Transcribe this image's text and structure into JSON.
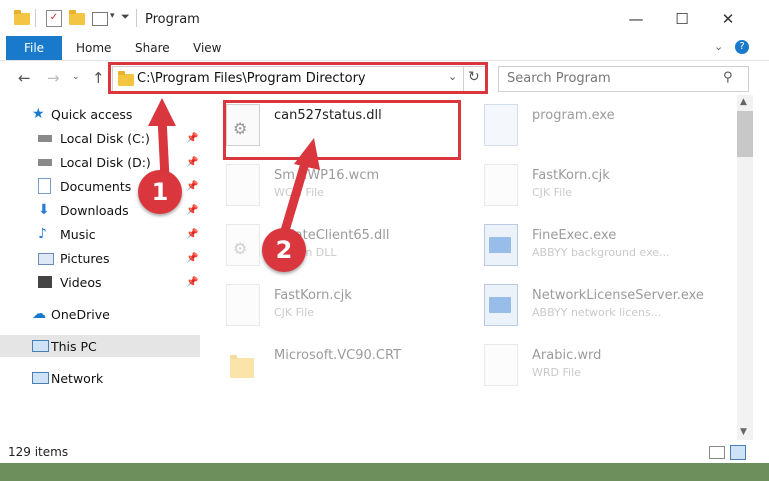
{
  "window": {
    "title": "Program"
  },
  "ribbon": {
    "tabs": [
      "File",
      "Home",
      "Share",
      "View"
    ]
  },
  "address": {
    "path": "C:\\Program Files\\Program Directory"
  },
  "search": {
    "placeholder": "Search Program"
  },
  "nav": {
    "quick_access": "Quick access",
    "items": [
      "Local Disk (C:)",
      "Local Disk (D:)",
      "Documents",
      "Downloads",
      "Music",
      "Pictures",
      "Videos"
    ],
    "onedrive": "OneDrive",
    "thispc": "This PC",
    "network": "Network"
  },
  "files": [
    {
      "name": "can527status.dll",
      "sub": ""
    },
    {
      "name": "program.exe",
      "sub": ""
    },
    {
      "name": "Sm...WP16.wcm",
      "sub": "WCM File"
    },
    {
      "name": "FastKorn.cjk",
      "sub": "CJK File"
    },
    {
      "name": "...dateClient65.dll",
      "sub": "...ation DLL"
    },
    {
      "name": "FineExec.exe",
      "sub": "ABBYY background exe..."
    },
    {
      "name": "FastKorn.cjk",
      "sub": "CJK File"
    },
    {
      "name": "NetworkLicenseServer.exe",
      "sub": "ABBYY network licens..."
    },
    {
      "name": "Microsoft.VC90.CRT",
      "sub": ""
    },
    {
      "name": "Arabic.wrd",
      "sub": "WRD File"
    }
  ],
  "status": {
    "items_count": "129 items"
  },
  "annotations": {
    "step1": "1",
    "step2": "2"
  },
  "colors": {
    "accent": "#1979ca",
    "highlight": "#d9363e"
  }
}
